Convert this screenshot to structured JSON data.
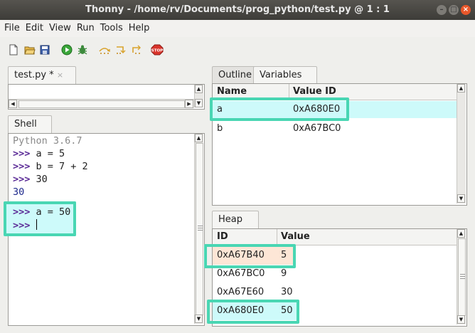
{
  "window": {
    "title": "Thonny  -  /home/rv/Documents/prog_python/test.py  @  1 : 1"
  },
  "menu": [
    "File",
    "Edit",
    "View",
    "Run",
    "Tools",
    "Help"
  ],
  "toolbar": {
    "icons": [
      "new-file-icon",
      "open-folder-icon",
      "save-icon",
      "run-icon",
      "debug-icon",
      "step-over-icon",
      "step-into-icon",
      "step-out-icon",
      "stop-icon"
    ],
    "stop_label": "STOP"
  },
  "editor": {
    "tab_label": "test.py *",
    "tab_close": "×"
  },
  "shell": {
    "tab_label": "Shell",
    "banner": "Python 3.6.7",
    "prompt": ">>>",
    "lines": [
      {
        "prompt": ">>>",
        "text": " a = 5"
      },
      {
        "prompt": ">>>",
        "text": " b = 7 + 2"
      },
      {
        "prompt": ">>>",
        "text": " 30"
      },
      {
        "prompt": "",
        "text": "30"
      },
      {
        "prompt": ">>>",
        "text": " a = 50"
      },
      {
        "prompt": ">>>",
        "text": " "
      }
    ]
  },
  "variables": {
    "tabs": [
      "Outline",
      "Variables"
    ],
    "active_tab": "Variables",
    "columns": [
      "Name",
      "Value ID"
    ],
    "rows": [
      {
        "name": "a",
        "value_id": "0xA680E0"
      },
      {
        "name": "b",
        "value_id": "0xA67BC0"
      }
    ]
  },
  "heap": {
    "tab_label": "Heap",
    "columns": [
      "ID",
      "Value"
    ],
    "rows": [
      {
        "id": "0xA67B40",
        "value": "5"
      },
      {
        "id": "0xA67BC0",
        "value": "9"
      },
      {
        "id": "0xA67E60",
        "value": "30"
      },
      {
        "id": "0xA680E0",
        "value": "50"
      }
    ]
  },
  "colors": {
    "highlight_border": "#49d6b3",
    "highlight_fill": "#cdfafa",
    "highlight_fill_orange": "#fde6d6",
    "prompt": "#5a2a96",
    "output": "#1e2a8c",
    "banner": "#8a8a8a"
  }
}
